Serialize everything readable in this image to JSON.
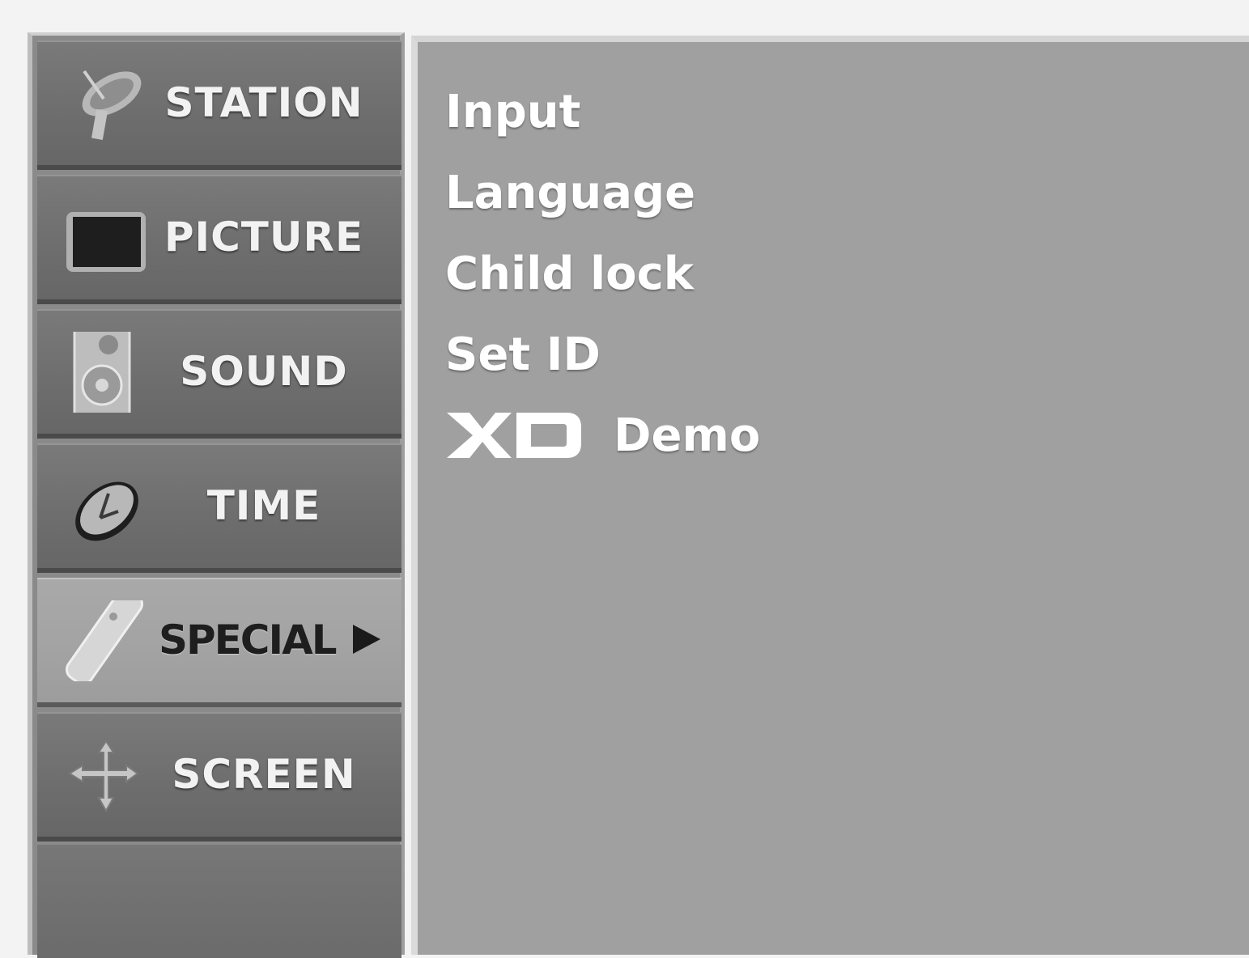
{
  "menu": {
    "items": [
      {
        "label": "STATION",
        "icon": "satellite-dish-icon"
      },
      {
        "label": "PICTURE",
        "icon": "tv-screen-icon"
      },
      {
        "label": "SOUND",
        "icon": "speaker-icon"
      },
      {
        "label": "TIME",
        "icon": "clock-icon"
      },
      {
        "label": "SPECIAL",
        "icon": "remote-control-icon",
        "selected": true
      },
      {
        "label": "SCREEN",
        "icon": "move-arrows-icon"
      }
    ]
  },
  "submenu": {
    "options": [
      {
        "label": "Input"
      },
      {
        "label": "Language"
      },
      {
        "label": "Child lock"
      },
      {
        "label": "Set ID"
      },
      {
        "label": "Demo",
        "logo": "XD"
      }
    ]
  },
  "colors": {
    "menu_bg": "#7a7a7a",
    "selected_bg": "#a9a9a9",
    "panel_bg": "#a0a0a0",
    "text": "#ffffff"
  }
}
